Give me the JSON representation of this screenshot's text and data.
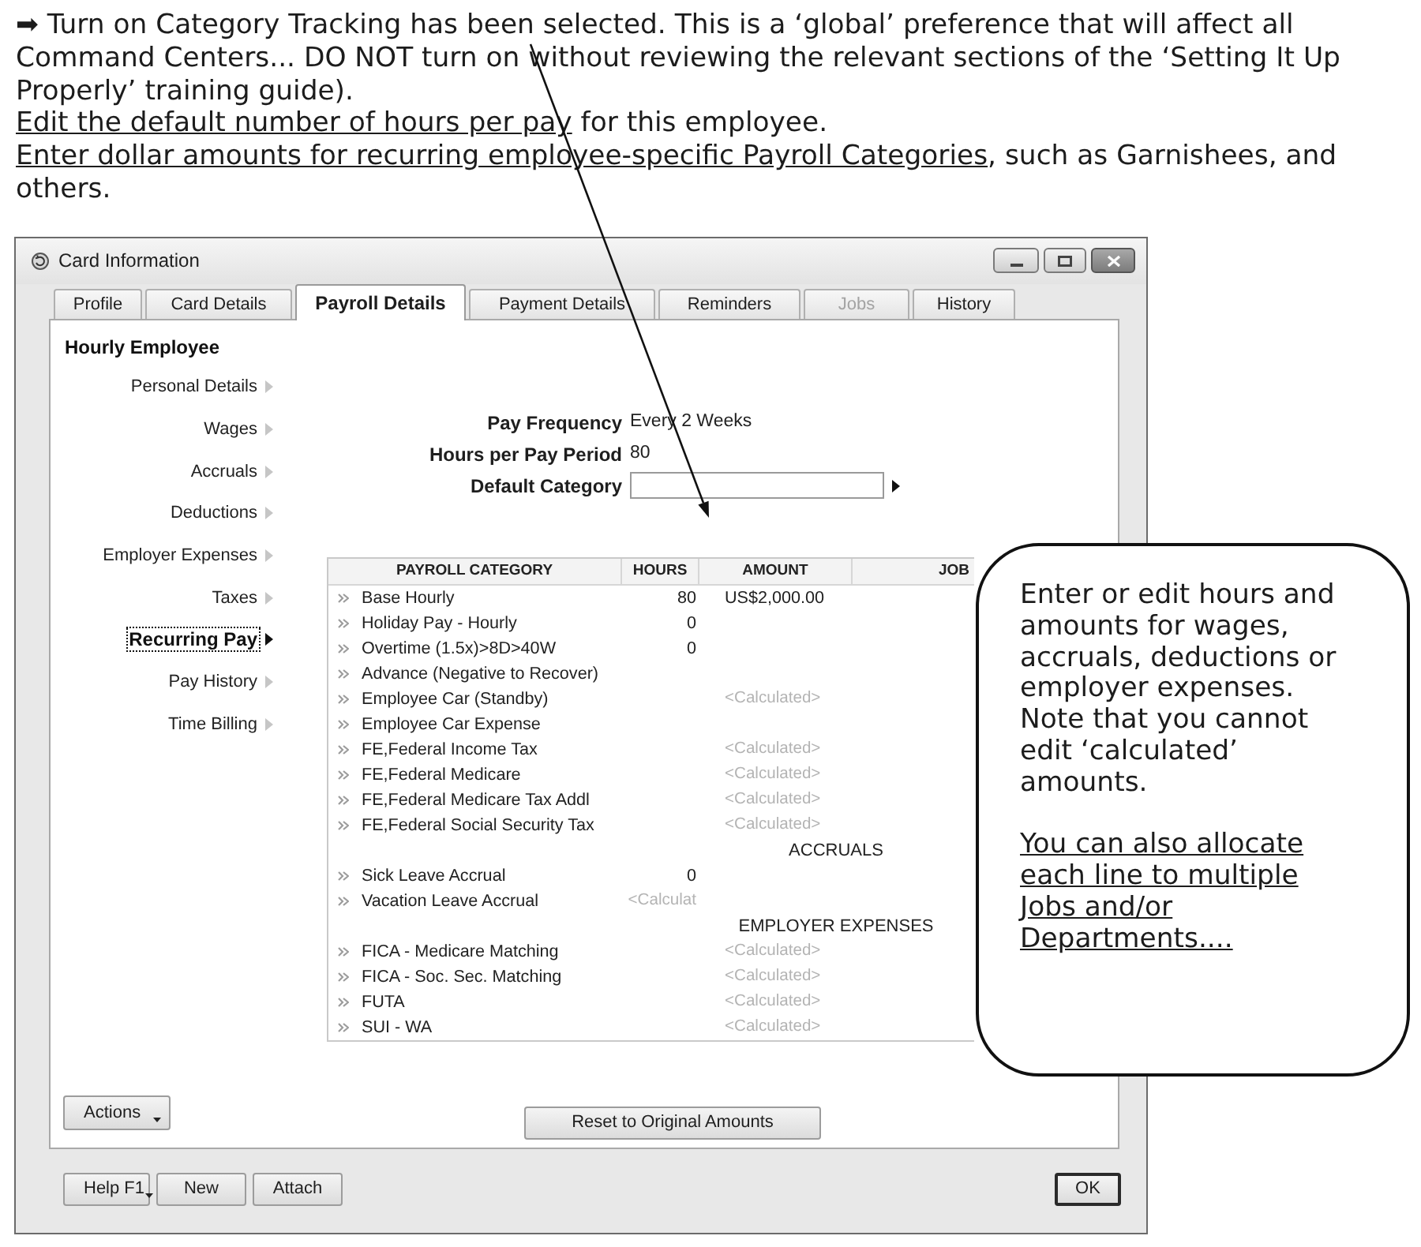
{
  "document": {
    "paragraphs": [
      {
        "text": "➡ Turn on Category Tracking has been selected. This is a ‘global’ preference that will affect all Command Centers... DO NOT turn on without reviewing the relevant sections of the ‘Setting It Up Properly’ training guide)."
      },
      {
        "link": "Edit the default number of hours per pay",
        "text": " for this employee."
      },
      {
        "link": "Enter dollar amounts for recurring employee-specific Payroll Categories",
        "text": ", such as Garnishees, and others."
      }
    ]
  },
  "window": {
    "title": "Card Information",
    "tabs": [
      {
        "label": "Profile",
        "selected": false,
        "disabled": false
      },
      {
        "label": "Card Details",
        "selected": false,
        "disabled": false
      },
      {
        "label": "Payroll Details",
        "selected": true,
        "disabled": false
      },
      {
        "label": "Payment Details",
        "selected": false,
        "disabled": false
      },
      {
        "label": "Reminders",
        "selected": false,
        "disabled": false
      },
      {
        "label": "Jobs",
        "selected": false,
        "disabled": true
      },
      {
        "label": "History",
        "selected": false,
        "disabled": false
      }
    ],
    "record_type": "Hourly Employee",
    "sidebar": [
      {
        "label": "Personal Details",
        "selected": false
      },
      {
        "label": "Wages",
        "selected": false
      },
      {
        "label": "Accruals",
        "selected": false
      },
      {
        "label": "Deductions",
        "selected": false
      },
      {
        "label": "Employer Expenses",
        "selected": false
      },
      {
        "label": "Taxes",
        "selected": false
      },
      {
        "label": "Recurring Pay",
        "selected": true
      },
      {
        "label": "Pay History",
        "selected": false
      },
      {
        "label": "Time Billing",
        "selected": false
      }
    ],
    "fields": [
      {
        "kind": "readonly",
        "label": "Pay Frequency",
        "value": "Every 2 Weeks"
      },
      {
        "kind": "readonly",
        "label": "Hours per Pay Period",
        "value": "80"
      },
      {
        "kind": "lookup",
        "label": "Default Category"
      }
    ],
    "table": {
      "columns": [
        "PAYROLL CATEGORY",
        "HOURS",
        "AMOUNT",
        "JOB"
      ],
      "rows": [
        {
          "kind": "item",
          "category": "Base Hourly",
          "hours": {
            "text": "80",
            "disabled": false
          },
          "amount": {
            "text": "US$2,000.00",
            "disabled": false
          }
        },
        {
          "kind": "item",
          "category": "Holiday Pay - Hourly",
          "hours": {
            "text": "0",
            "disabled": false
          }
        },
        {
          "kind": "item",
          "category": "Overtime (1.5x)>8D>40W",
          "hours": {
            "text": "0",
            "disabled": false
          }
        },
        {
          "kind": "item",
          "category": "Advance (Negative to Recover)"
        },
        {
          "kind": "item",
          "category": "Employee Car (Standby)",
          "amount": {
            "text": "<Calculated>",
            "disabled": true
          }
        },
        {
          "kind": "item",
          "category": "Employee Car Expense"
        },
        {
          "kind": "item",
          "category": "FE,Federal Income Tax",
          "amount": {
            "text": "<Calculated>",
            "disabled": true
          }
        },
        {
          "kind": "item",
          "category": "FE,Federal Medicare",
          "amount": {
            "text": "<Calculated>",
            "disabled": true
          }
        },
        {
          "kind": "item",
          "category": "FE,Federal Medicare Tax Addl",
          "amount": {
            "text": "<Calculated>",
            "disabled": true
          }
        },
        {
          "kind": "item",
          "category": "FE,Federal Social Security Tax",
          "amount": {
            "text": "<Calculated>",
            "disabled": true
          }
        },
        {
          "kind": "section",
          "title": "ACCRUALS"
        },
        {
          "kind": "item",
          "category": "Sick Leave Accrual",
          "hours": {
            "text": "0",
            "disabled": false
          }
        },
        {
          "kind": "item",
          "category": "Vacation Leave Accrual",
          "hours": {
            "text": "<Calculat",
            "disabled": true
          }
        },
        {
          "kind": "section",
          "title": "EMPLOYER EXPENSES"
        },
        {
          "kind": "item",
          "category": "FICA - Medicare Matching",
          "amount": {
            "text": "<Calculated>",
            "disabled": true
          }
        },
        {
          "kind": "item",
          "category": "FICA - Soc. Sec. Matching",
          "amount": {
            "text": "<Calculated>",
            "disabled": true
          }
        },
        {
          "kind": "item",
          "category": "FUTA",
          "amount": {
            "text": "<Calculated>",
            "disabled": true
          }
        },
        {
          "kind": "item",
          "category": "SUI - WA",
          "amount": {
            "text": "<Calculated>",
            "disabled": true
          }
        }
      ]
    },
    "actions_button": "Actions",
    "reset_button": "Reset to Original Amounts",
    "footer_buttons": [
      {
        "label": "Help F1",
        "kind": "menu"
      },
      {
        "label": "New",
        "kind": "plain"
      },
      {
        "label": "Attach",
        "kind": "plain"
      }
    ],
    "default_button": "OK"
  },
  "callout": {
    "paragraphs": [
      {
        "text": "Enter or edit hours and amounts for wages, accruals, deductions or employer expenses. Note that you cannot edit ‘calculated’ amounts.",
        "underlined": false
      },
      {
        "text": "You can also allocate each line to multiple Jobs and/or Departments....",
        "underlined": true
      }
    ]
  }
}
